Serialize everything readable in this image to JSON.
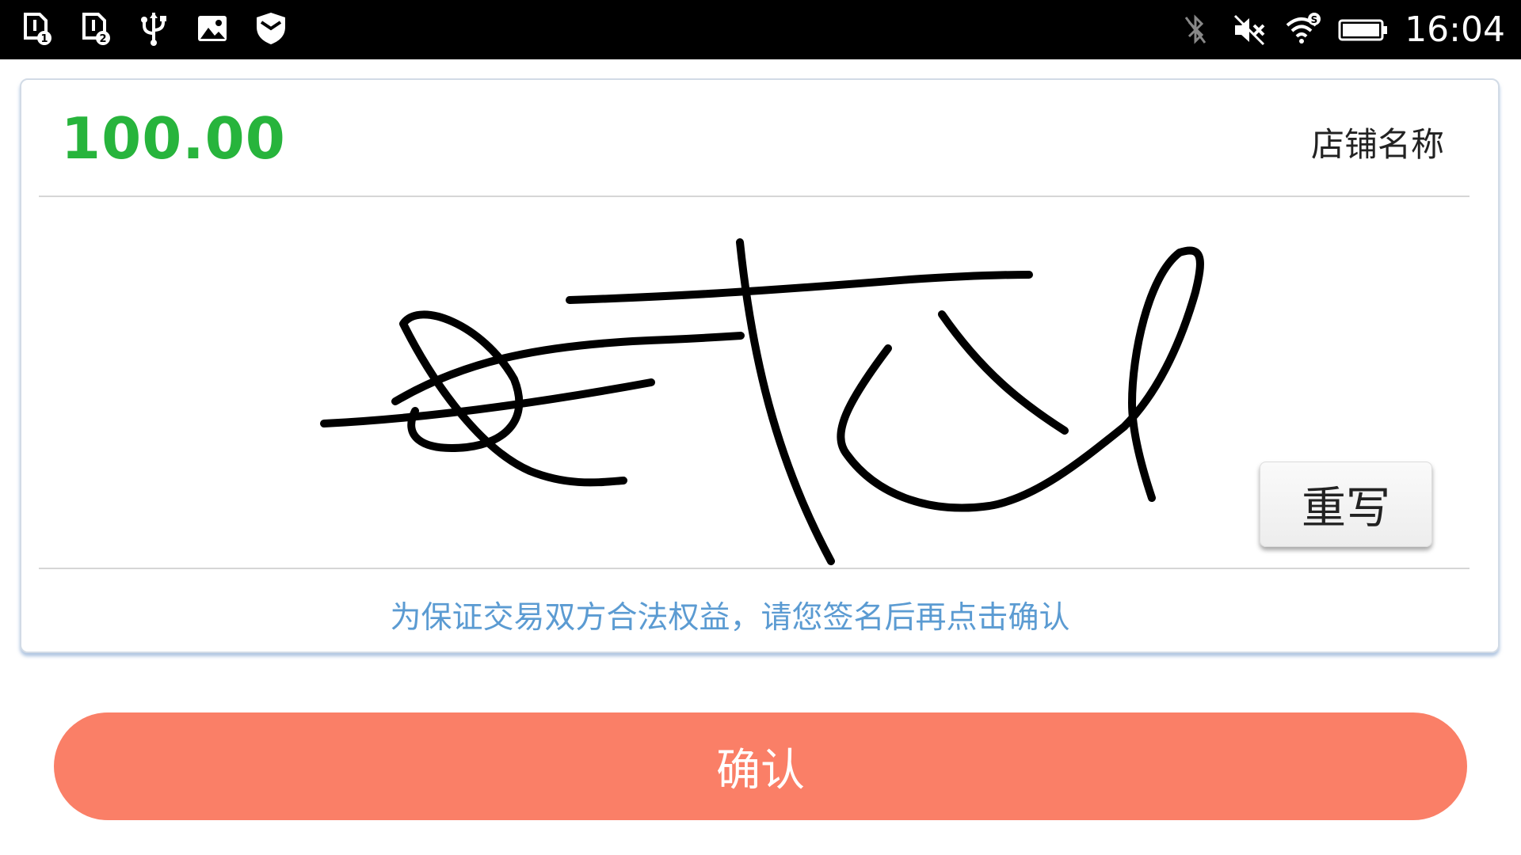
{
  "status_bar": {
    "time": "16:04",
    "left_icons": [
      "sim-card-1-icon",
      "sim-card-2-icon",
      "usb-icon",
      "gallery-icon",
      "shield-icon"
    ],
    "right_icons": [
      "bluetooth-off-icon",
      "mute-icon",
      "wifi-icon",
      "battery-icon"
    ]
  },
  "payment": {
    "amount": "100.00",
    "store_name": "店铺名称",
    "amount_color": "#27b43c"
  },
  "signature": {
    "rewrite_label": "重写",
    "hint": "为保证交易双方合法权益，请您签名后再点击确认",
    "hint_color": "#5b9bd2"
  },
  "confirm": {
    "label": "确认",
    "color": "#fa7f67"
  }
}
